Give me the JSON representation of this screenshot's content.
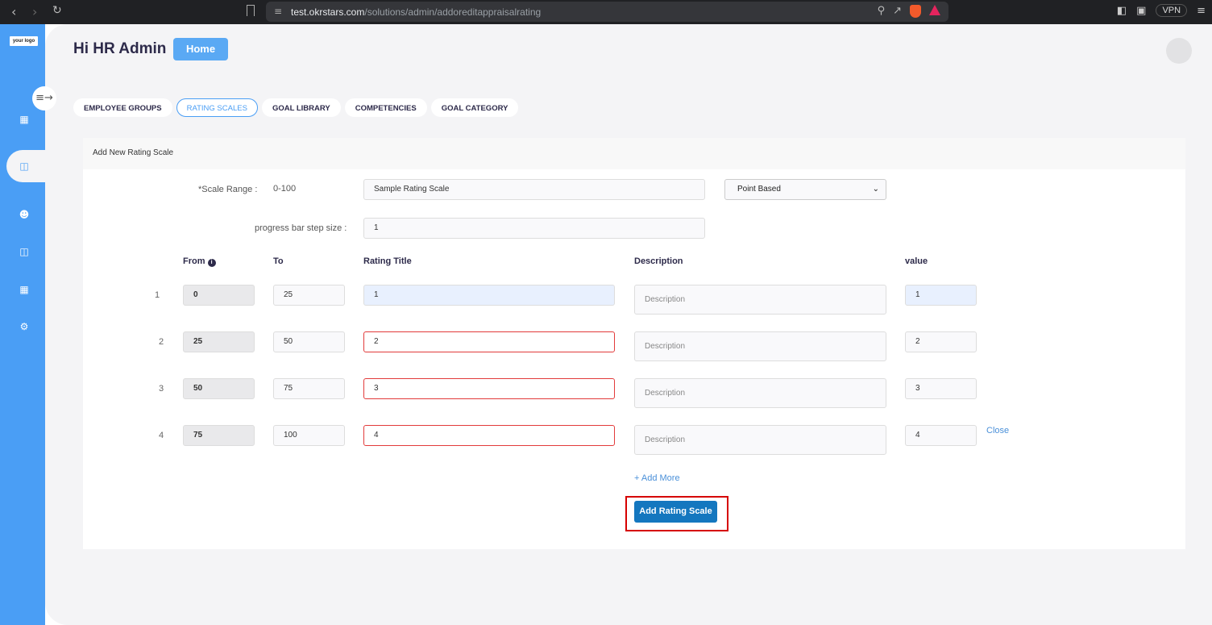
{
  "browser": {
    "url_host": "test.okrstars.com",
    "url_path": "/solutions/admin/addoreditappraisalrating",
    "vpn_label": "VPN"
  },
  "sidebar": {
    "logo_text": "your logo",
    "accent": "#4a9ef5",
    "icons": [
      "dashboard-icon",
      "appraisal-icon",
      "users-icon",
      "book-icon",
      "report-icon",
      "settings-icon"
    ]
  },
  "header": {
    "greeting": "Hi HR Admin",
    "home_label": "Home"
  },
  "tabs": [
    {
      "label": "EMPLOYEE GROUPS",
      "active": false
    },
    {
      "label": "RATING SCALES",
      "active": true
    },
    {
      "label": "GOAL LIBRARY",
      "active": false
    },
    {
      "label": "COMPETENCIES",
      "active": false
    },
    {
      "label": "GOAL CATEGORY",
      "active": false
    }
  ],
  "form": {
    "title": "Add New Rating Scale",
    "scale_range_label": "*Scale Range :",
    "scale_range_value": "0-100",
    "scale_name": "Sample Rating Scale",
    "scale_type": "Point Based",
    "step_label": "progress bar step size :",
    "step_value": "1",
    "columns": {
      "from": "From",
      "to": "To",
      "rating_title": "Rating Title",
      "description": "Description",
      "value": "value"
    },
    "rows": [
      {
        "num": "1",
        "from": "0",
        "to": "25",
        "title": "1",
        "description_placeholder": "Description",
        "value": "1"
      },
      {
        "num": "2",
        "from": "25",
        "to": "50",
        "title": "2",
        "description_placeholder": "Description",
        "value": "2"
      },
      {
        "num": "3",
        "from": "50",
        "to": "75",
        "title": "3",
        "description_placeholder": "Description",
        "value": "3"
      },
      {
        "num": "4",
        "from": "75",
        "to": "100",
        "title": "4",
        "description_placeholder": "Description",
        "value": "4"
      }
    ],
    "close_label": "Close",
    "add_more_label": "+ Add More",
    "submit_label": "Add Rating Scale"
  }
}
